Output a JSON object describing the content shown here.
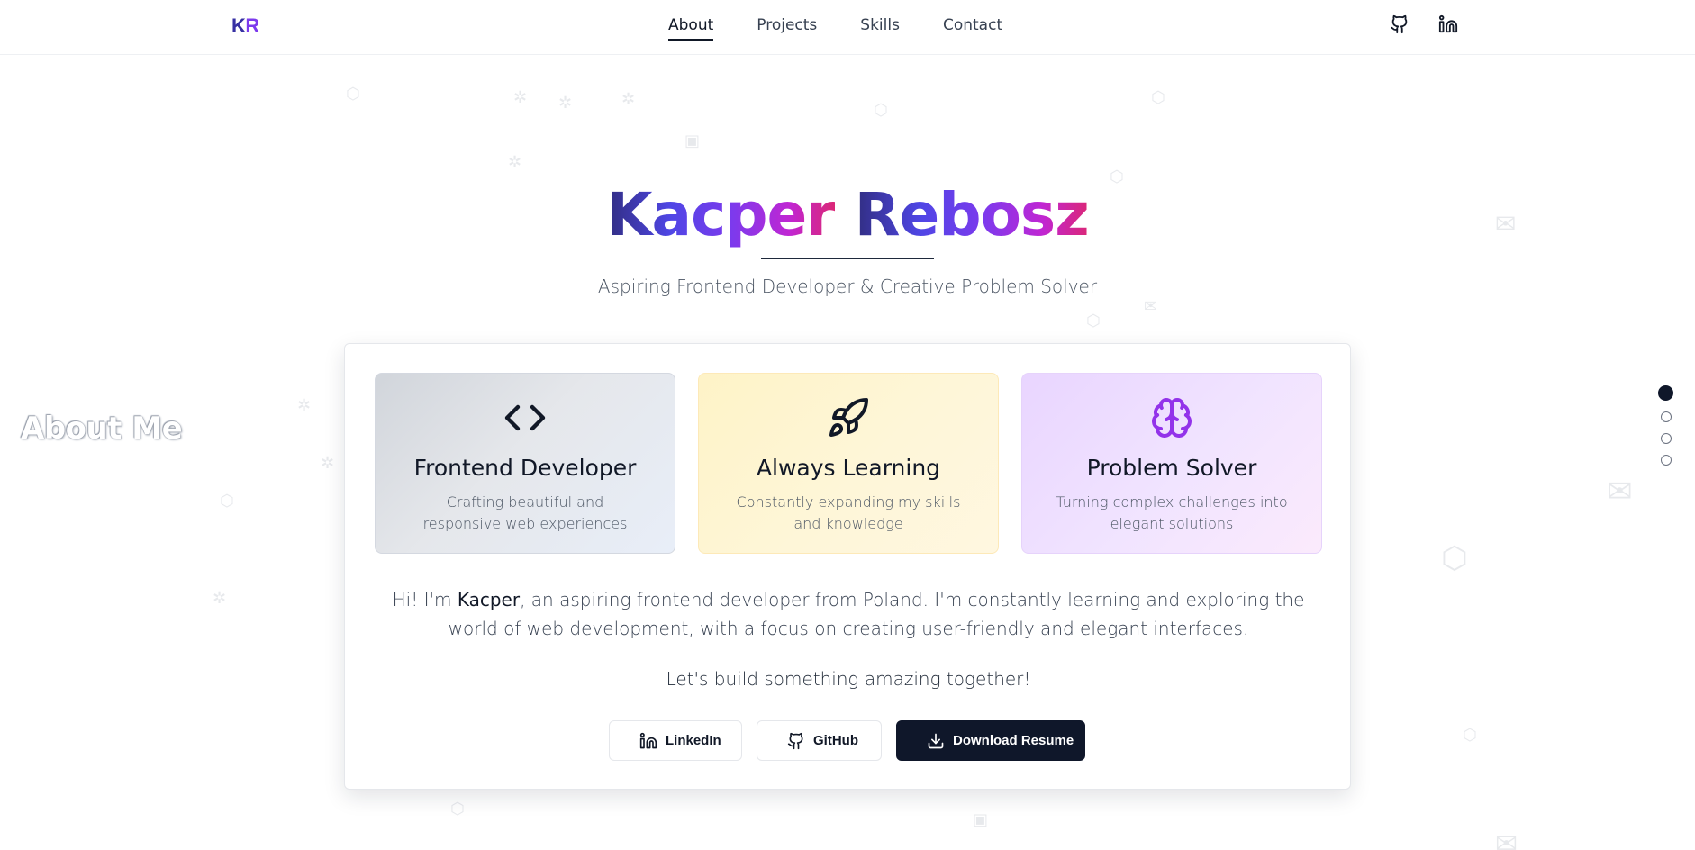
{
  "header": {
    "logo_k": "K",
    "logo_r": "R",
    "nav": [
      {
        "label": "About",
        "active": true
      },
      {
        "label": "Projects",
        "active": false
      },
      {
        "label": "Skills",
        "active": false
      },
      {
        "label": "Contact",
        "active": false
      }
    ],
    "social_icons": [
      "github-icon",
      "linkedin-icon"
    ]
  },
  "hero": {
    "first_name": "Kacper",
    "last_name": "Rebosz",
    "subtitle": "Aspiring Frontend Developer & Creative Problem Solver"
  },
  "section_label": "About Me",
  "features": [
    {
      "icon": "code-icon",
      "title": "Frontend Developer",
      "text": "Crafting beautiful and responsive web experiences"
    },
    {
      "icon": "rocket-icon",
      "title": "Always Learning",
      "text": "Constantly expanding my skills and knowledge"
    },
    {
      "icon": "brain-icon",
      "title": "Problem Solver",
      "text": "Turning complex challenges into elegant solutions"
    }
  ],
  "bio": {
    "prefix": "Hi! I'm ",
    "name": "Kacper",
    "suffix": ", an aspiring frontend developer from Poland. I'm constantly learning and exploring the world of web development, with a focus on creating user-friendly and elegant interfaces."
  },
  "cta": "Let's build something amazing together!",
  "buttons": {
    "linkedin": "LinkedIn",
    "github": "GitHub",
    "download": "Download Resume"
  },
  "section_dots": {
    "count": 4,
    "active_index": 0
  },
  "colors": {
    "primary_dark": "#0f172a",
    "gradient_start": "#312e81",
    "gradient_mid": "#7c3aed",
    "gradient_end": "#db2777"
  }
}
